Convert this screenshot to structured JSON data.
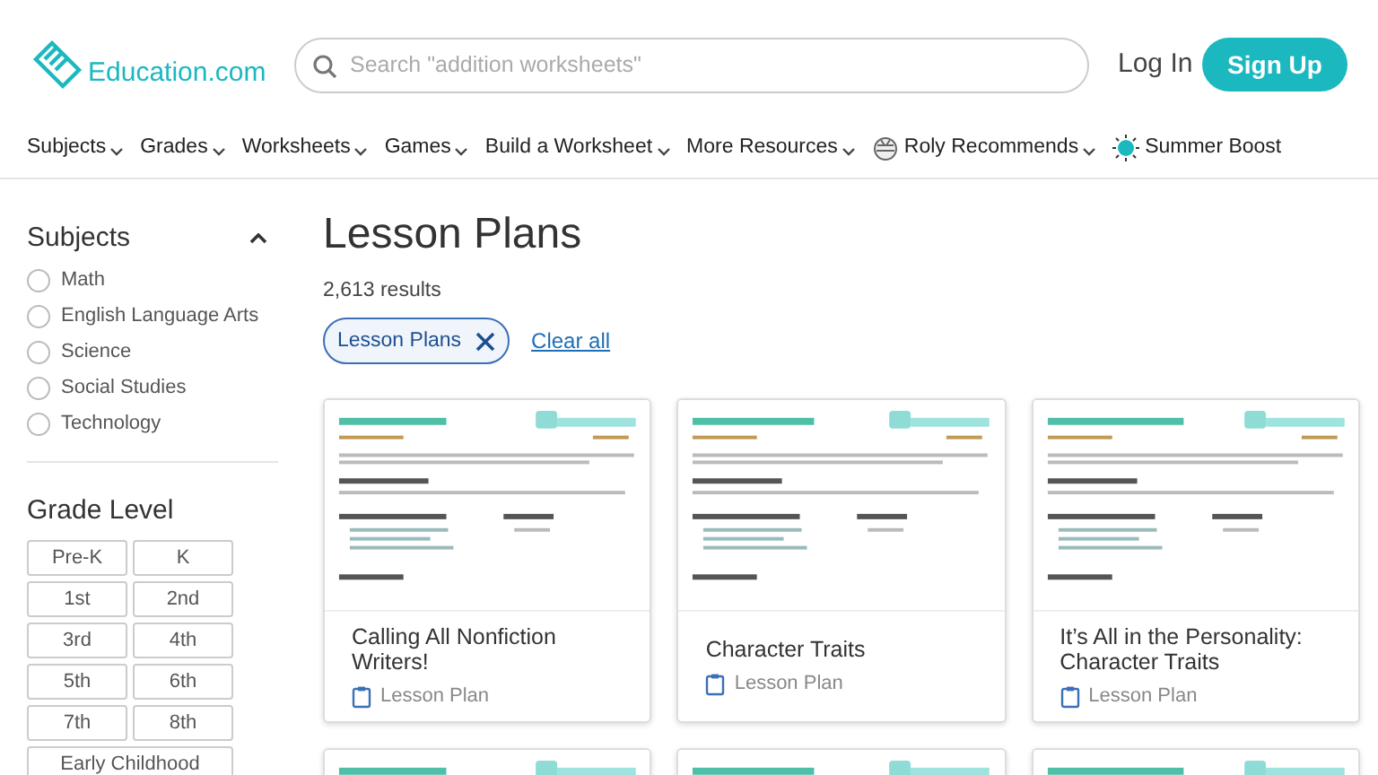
{
  "header": {
    "logo": "Education.com",
    "search": {
      "placeholder": "Search \"addition worksheets\""
    },
    "login": "Log In",
    "signup": "Sign Up"
  },
  "nav": [
    {
      "label": "Subjects",
      "kind": "menu"
    },
    {
      "label": "Grades",
      "kind": "menu"
    },
    {
      "label": "Worksheets",
      "kind": "menu"
    },
    {
      "label": "Games",
      "kind": "menu"
    },
    {
      "label": "Build a Worksheet",
      "kind": "menu"
    },
    {
      "label": "More Resources",
      "kind": "menu"
    },
    {
      "label": "Roly Recommends",
      "kind": "roly"
    },
    {
      "label": "Summer Boost",
      "kind": "sun"
    }
  ],
  "sidebar": {
    "subjects": {
      "title": "Subjects",
      "expanded": true,
      "items": [
        {
          "label": "Math",
          "checked": false
        },
        {
          "label": "English Language Arts",
          "checked": false
        },
        {
          "label": "Science",
          "checked": false
        },
        {
          "label": "Social Studies",
          "checked": false
        },
        {
          "label": "Technology",
          "checked": false
        }
      ]
    },
    "grade_level": {
      "title": "Grade Level",
      "items": [
        {
          "label": "Pre-K",
          "selected": false
        },
        {
          "label": "K",
          "selected": false
        },
        {
          "label": "1st",
          "selected": false
        },
        {
          "label": "2nd",
          "selected": false
        },
        {
          "label": "3rd",
          "selected": false
        },
        {
          "label": "4th",
          "selected": false
        },
        {
          "label": "5th",
          "selected": false
        },
        {
          "label": "6th",
          "selected": false
        },
        {
          "label": "7th",
          "selected": false
        },
        {
          "label": "8th",
          "selected": false
        },
        {
          "label": "Early Childhood",
          "selected": false
        }
      ]
    }
  },
  "main": {
    "title": "Lesson Plans",
    "results": "2,613 results",
    "filters": [
      {
        "label": "Lesson Plans"
      }
    ],
    "clear": "Clear all",
    "cards": [
      {
        "title": "Calling All Nonfiction Writers!",
        "type": "Lesson Plan",
        "kind": "picture"
      },
      {
        "title": "Character Traits",
        "type": "Lesson Plan",
        "kind": "picture"
      },
      {
        "title": "It’s All in the Personality: Character Traits",
        "type": "Lesson Plan",
        "kind": "picture"
      },
      {
        "kind": "picture"
      },
      {
        "kind": "picture"
      },
      {
        "kind": "picture"
      }
    ]
  }
}
